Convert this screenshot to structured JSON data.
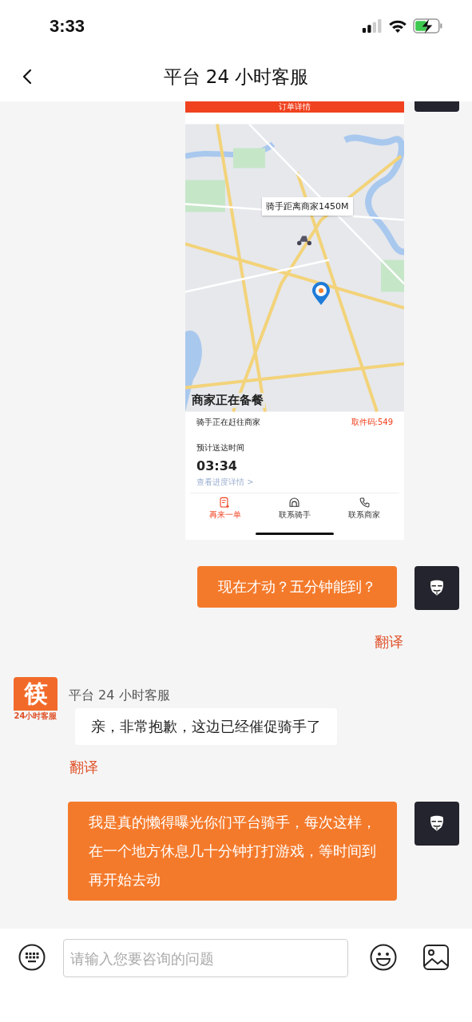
{
  "status_bar": {
    "time": "3:33"
  },
  "nav": {
    "title": "平台 24 小时客服"
  },
  "messages": [
    {
      "kind": "user_screenshot",
      "screenshot": {
        "header": "订单详情",
        "map_label": "骑手距离商家1450M",
        "status": "商家正在备餐",
        "rider_status": "骑手正在赶往商家",
        "pickup_code": "取件码:549",
        "eta_label": "预计送达时间",
        "eta": "03:34",
        "details_link": "查看进度详情 >",
        "actions": [
          {
            "kind": "reorder",
            "label": "再来一单"
          },
          {
            "kind": "rider",
            "label": "联系骑手"
          },
          {
            "kind": "phone",
            "label": "联系商家"
          }
        ]
      }
    },
    {
      "kind": "user_text",
      "text": "现在才动？五分钟能到？",
      "translate": "翻译"
    },
    {
      "kind": "agent_text",
      "sender_name": "平台 24 小时客服",
      "logo_text": "筷",
      "logo_caption": "24小时客服",
      "text": "亲，非常抱歉，这边已经催促骑手了",
      "translate": "翻译"
    },
    {
      "kind": "user_text",
      "text": "我是真的懒得曝光你们平台骑手，每次这样，在一个地方休息几十分钟打打游戏，等时间到再开始去动"
    }
  ],
  "input": {
    "placeholder": "请输入您要咨询的问题"
  }
}
